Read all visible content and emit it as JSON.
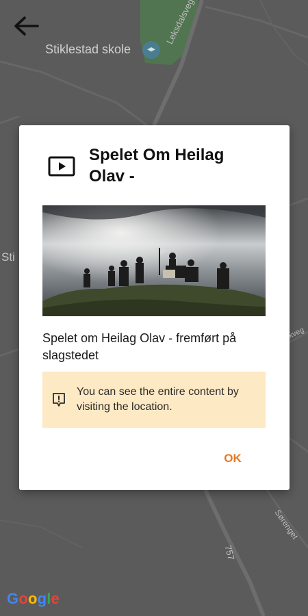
{
  "map": {
    "labels": {
      "school": "Stiklestad skole",
      "road_leksdal": "Leksdalsvegen",
      "place_partial": "Sti",
      "road_soerenget": "Sørenget",
      "road_757": "757",
      "road_edge": "kveg"
    },
    "attribution": {
      "letters": [
        {
          "char": "G",
          "color": "#4285F4"
        },
        {
          "char": "o",
          "color": "#EA4335"
        },
        {
          "char": "o",
          "color": "#FBBC05"
        },
        {
          "char": "g",
          "color": "#4285F4"
        },
        {
          "char": "l",
          "color": "#34A853"
        },
        {
          "char": "e",
          "color": "#EA4335"
        }
      ]
    }
  },
  "toolbar": {
    "back_icon": "arrow-left-icon"
  },
  "dialog": {
    "type_icon": "video-play-icon",
    "title": "Spelet Om Heilag Olav -",
    "description": "Spelet om Heilag Olav - fremført på slagstedet",
    "notice": {
      "icon": "info-alert-icon",
      "text": "You can see the entire content by visiting the location."
    },
    "ok_label": "OK"
  },
  "colors": {
    "accent": "#e87722",
    "notice_bg": "#fde9c4",
    "map_bg": "#5b5b5b"
  }
}
